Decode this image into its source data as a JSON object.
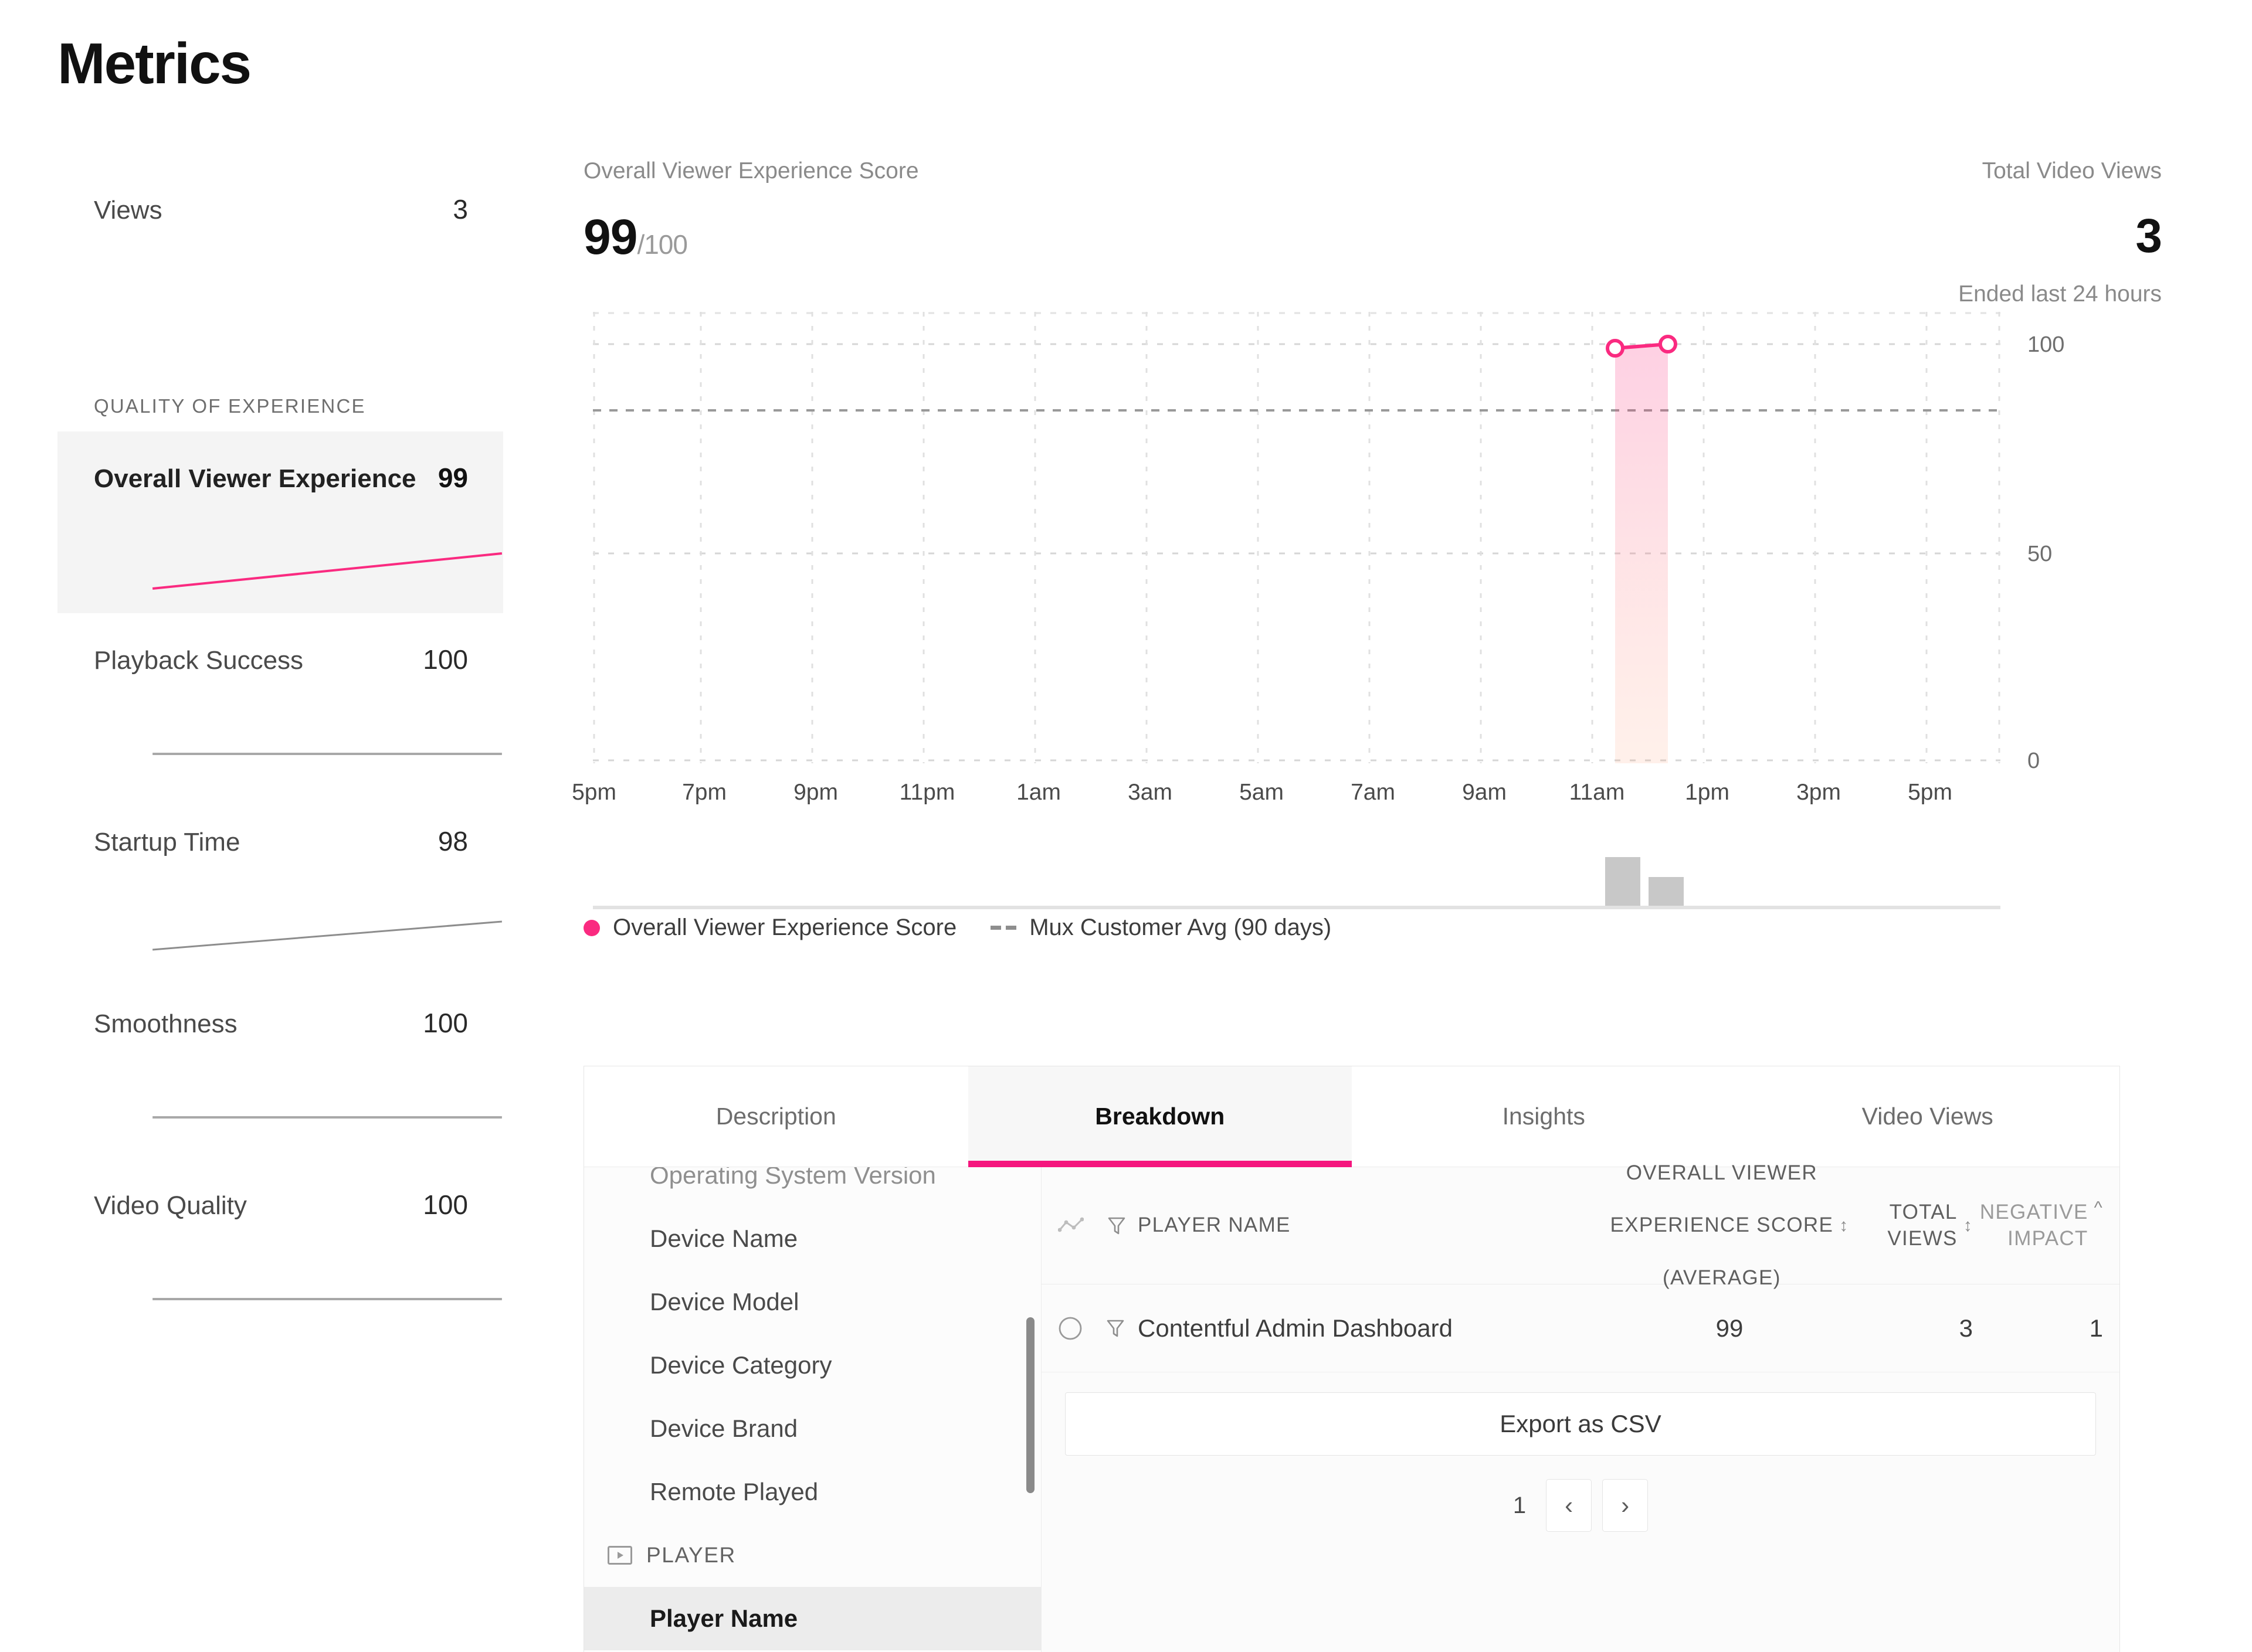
{
  "page": {
    "title": "Metrics"
  },
  "colors": {
    "accent": "#f5167e",
    "accent_line": "#fa2a80",
    "muted": "#8a8a8a",
    "bar": "#c8c8c8"
  },
  "sidebar": {
    "views": {
      "label": "Views",
      "value": "3"
    },
    "section_heading": "Quality of Experience",
    "metrics": [
      {
        "label": "Overall Viewer Experience",
        "value": "99",
        "active": true,
        "trend": "up",
        "color": "#fa2a80"
      },
      {
        "label": "Playback Success",
        "value": "100",
        "active": false,
        "trend": "flat",
        "color": "#9a9a9a"
      },
      {
        "label": "Startup Time",
        "value": "98",
        "active": false,
        "trend": "up",
        "color": "#7d7d7d"
      },
      {
        "label": "Smoothness",
        "value": "100",
        "active": false,
        "trend": "flat",
        "color": "#9a9a9a"
      },
      {
        "label": "Video Quality",
        "value": "100",
        "active": false,
        "trend": "flat",
        "color": "#9a9a9a"
      }
    ]
  },
  "kpis": {
    "score": {
      "label": "Overall Viewer Experience Score",
      "value": "99",
      "suffix": "/100"
    },
    "views": {
      "label": "Total Video Views",
      "value": "3",
      "sub": "Ended last 24 hours"
    }
  },
  "chart_data": {
    "type": "line",
    "title": "Overall Viewer Experience Score",
    "xlabel": "",
    "ylabel": "",
    "ylim": [
      0,
      100
    ],
    "yticks": [
      0,
      50,
      100
    ],
    "ytick_labels": [
      "0",
      "50",
      "100"
    ],
    "grid": true,
    "legend_position": "below",
    "x": [
      "5pm",
      "7pm",
      "9pm",
      "11pm",
      "1am",
      "3am",
      "5am",
      "7am",
      "9am",
      "11am",
      "1pm",
      "3pm",
      "5pm"
    ],
    "xtick_labels": [
      "5pm",
      "7pm",
      "9pm",
      "11pm",
      "1am",
      "3am",
      "5am",
      "7am",
      "9am",
      "11am",
      "1pm",
      "3pm",
      "5pm"
    ],
    "series": [
      {
        "name": "Overall Viewer Experience Score",
        "type": "line",
        "color": "#fa2a80",
        "marker": "circle-open",
        "area_fill": true,
        "points": [
          {
            "x": "10:30am",
            "x_frac": 0.735,
            "y": 99
          },
          {
            "x": "11:30am",
            "x_frac": 0.758,
            "y": 100
          }
        ]
      },
      {
        "name": "Mux Customer Avg (90 days)",
        "type": "reference-line",
        "style": "dashed",
        "color": "#9a9a9a",
        "y": 84
      }
    ],
    "secondary_bars": {
      "name": "Video Views",
      "color": "#c8c8c8",
      "bars": [
        {
          "x_frac": 0.733,
          "value": 2
        },
        {
          "x_frac": 0.756,
          "value": 1
        }
      ]
    },
    "legend": [
      {
        "label": "Overall Viewer Experience Score",
        "marker": "dot",
        "color": "#fa2a80"
      },
      {
        "label": "Mux Customer Avg (90 days)",
        "marker": "dash",
        "color": "#8e8e8e"
      }
    ]
  },
  "tabs": [
    {
      "label": "Description",
      "active": false
    },
    {
      "label": "Breakdown",
      "active": true
    },
    {
      "label": "Insights",
      "active": false
    },
    {
      "label": "Video Views",
      "active": false
    }
  ],
  "breakdown": {
    "items": [
      {
        "label": "Operating System Version",
        "type": "item",
        "active": false,
        "clipped": true
      },
      {
        "label": "Device Name",
        "type": "item",
        "active": false
      },
      {
        "label": "Device Model",
        "type": "item",
        "active": false
      },
      {
        "label": "Device Category",
        "type": "item",
        "active": false
      },
      {
        "label": "Device Brand",
        "type": "item",
        "active": false
      },
      {
        "label": "Remote Played",
        "type": "item",
        "active": false
      },
      {
        "label": "PLAYER",
        "type": "group",
        "icon": "player-icon"
      },
      {
        "label": "Player Name",
        "type": "item",
        "active": true
      }
    ]
  },
  "table": {
    "columns": [
      {
        "key": "name",
        "label": "Player Name"
      },
      {
        "key": "score",
        "label": "Overall Viewer Experience Score (Average)",
        "line1": "Overall Viewer",
        "line2": "Experience Score",
        "line3": "(Average)",
        "sort": "none"
      },
      {
        "key": "views",
        "label": "Total Views",
        "line1": "Total",
        "line2": "Views",
        "sort": "none"
      },
      {
        "key": "neg",
        "label": "Negative Impact",
        "line1": "Negative",
        "line2": "Impact",
        "sort": "asc"
      }
    ],
    "rows": [
      {
        "name": "Contentful Admin Dashboard",
        "score": "99",
        "views": "3",
        "neg": "1"
      }
    ],
    "export_label": "Export as CSV",
    "pagination": {
      "page": "1",
      "prev": "‹",
      "next": "›"
    }
  }
}
